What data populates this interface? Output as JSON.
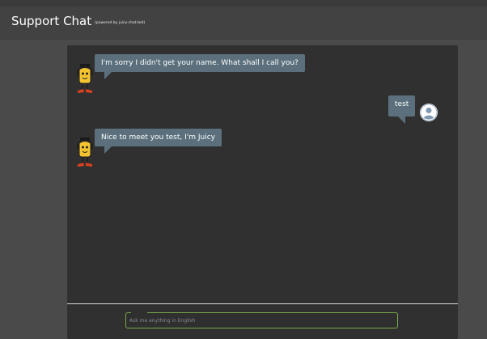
{
  "header": {
    "title": "Support Chat",
    "subtitle": "(powered by juicy-chat-bot)"
  },
  "messages": [
    {
      "sender": "bot",
      "text": "I'm sorry I didn't get your name. What shall I call you?"
    },
    {
      "sender": "user",
      "text": "test"
    },
    {
      "sender": "bot",
      "text": "Nice to meet you test, I'm Juicy"
    }
  ],
  "input": {
    "placeholder": "Ask me anything in English",
    "value": ""
  },
  "colors": {
    "bubble": "#5b707c",
    "input_border": "#7aa84a",
    "panel": "#303030"
  }
}
